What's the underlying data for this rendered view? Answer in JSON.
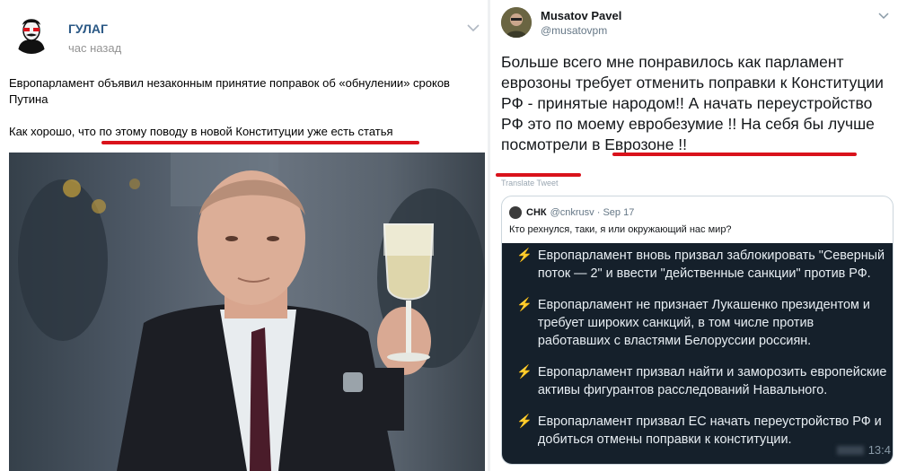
{
  "vk_post": {
    "author": "ГУЛАГ",
    "time": "час назад",
    "text1": "Европарламент объявил незаконным принятие поправок об «обнулении» сроков Путина",
    "text2_prefix": "Как хорошо, что ",
    "text2_highlight": "по этому поводу в новой Конституции уже есть статья"
  },
  "tweet": {
    "author": "Musatov Pavel",
    "handle": "@musatovpm",
    "text_plain": "Больше всего мне понравилось как парламент еврозоны требует отменить поправки к Конституции РФ - принятые народом!! А начать переустройство РФ это по моему евробезумие !! ",
    "text_highlight": "На себя бы лучше посмотрели в Еврозоне !!",
    "translate": "Translate Tweet",
    "quote": {
      "author": "СНК",
      "handle": "@cnkrusv · Sep 17",
      "question": "Кто рехнулся, таки, я или окружающий нас мир?",
      "bolt": "⚡",
      "items": [
        "Европарламент вновь призвал заблокировать \"Северный поток — 2\" и ввести \"действенные санкции\" против РФ.",
        "Европарламент не признает Лукашенко президентом и требует широких санкций, в том числе против работавших с властями Белоруссии россиян.",
        "Европарламент призвал найти и заморозить европейские активы фигурантов расследований Навального.",
        "Европарламент призвал ЕС начать переустройство РФ и добиться отмены поправки к конституции."
      ],
      "time": "13:4"
    }
  },
  "colors": {
    "vk_link": "#2a5885",
    "underline_red": "#d9121b",
    "quote_dark_bg": "#15202b",
    "bolt": "#f5b21a"
  }
}
